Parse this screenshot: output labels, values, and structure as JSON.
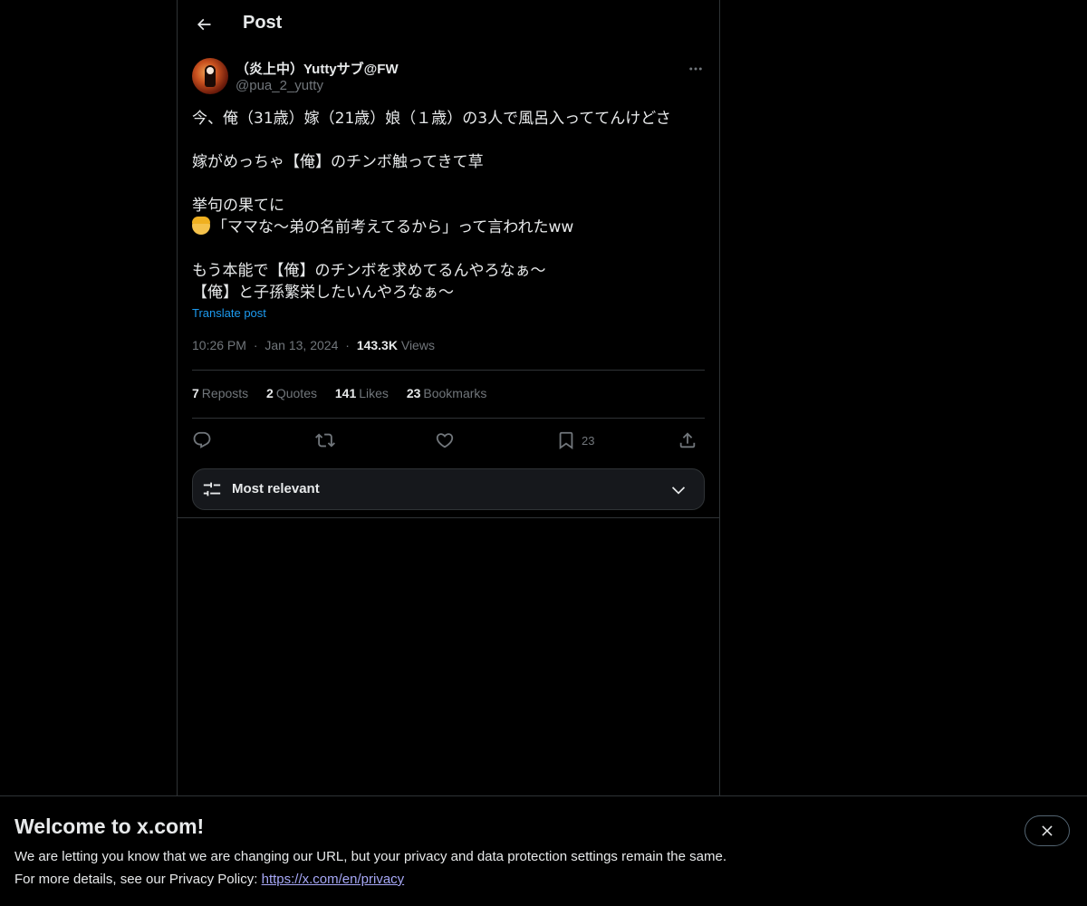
{
  "header": {
    "title": "Post"
  },
  "tweet": {
    "display_name": "（炎上中）Yuttyサブ@FW",
    "handle": "@pua_2_yutty",
    "lines": [
      "今、俺（31歳）嫁（21歳）娘（１歳）の3人で風呂入っててんけどさ",
      "",
      "嫁がめっちゃ【俺】のチンボ触ってきて草",
      "",
      "挙句の果てに",
      "「ママな〜弟の名前考えてるから」って言われたww",
      "",
      "もう本能で【俺】のチンボを求めてるんやろなぁ〜",
      "【俺】と子孫繁栄したいんやろなぁ〜"
    ],
    "translate_label": "Translate post",
    "time": "10:26 PM",
    "date": "Jan 13, 2024",
    "views_count": "143.3K",
    "views_label": "Views",
    "separator": "·"
  },
  "stats": {
    "reposts": {
      "count": "7",
      "label": "Reposts"
    },
    "quotes": {
      "count": "2",
      "label": "Quotes"
    },
    "likes": {
      "count": "141",
      "label": "Likes"
    },
    "bookmarks": {
      "count": "23",
      "label": "Bookmarks"
    }
  },
  "actions": {
    "reply_icon": "reply-icon",
    "repost_icon": "repost-icon",
    "like_icon": "heart-icon",
    "bookmark_icon": "bookmark-icon",
    "bookmark_count": "23",
    "share_icon": "share-icon"
  },
  "sort": {
    "label": "Most relevant"
  },
  "banner": {
    "title": "Welcome to x.com!",
    "line1": "We are letting you know that we are changing our URL, but your privacy and data protection settings remain the same.",
    "line2_prefix": "For more details, see our Privacy Policy:",
    "link": "https://x.com/en/privacy"
  },
  "colors": {
    "background": "#000000",
    "text": "#e7e9ea",
    "muted": "#71767b",
    "accent": "#1d9bf0",
    "border": "#2f3336",
    "link": "#a7a8f7"
  }
}
